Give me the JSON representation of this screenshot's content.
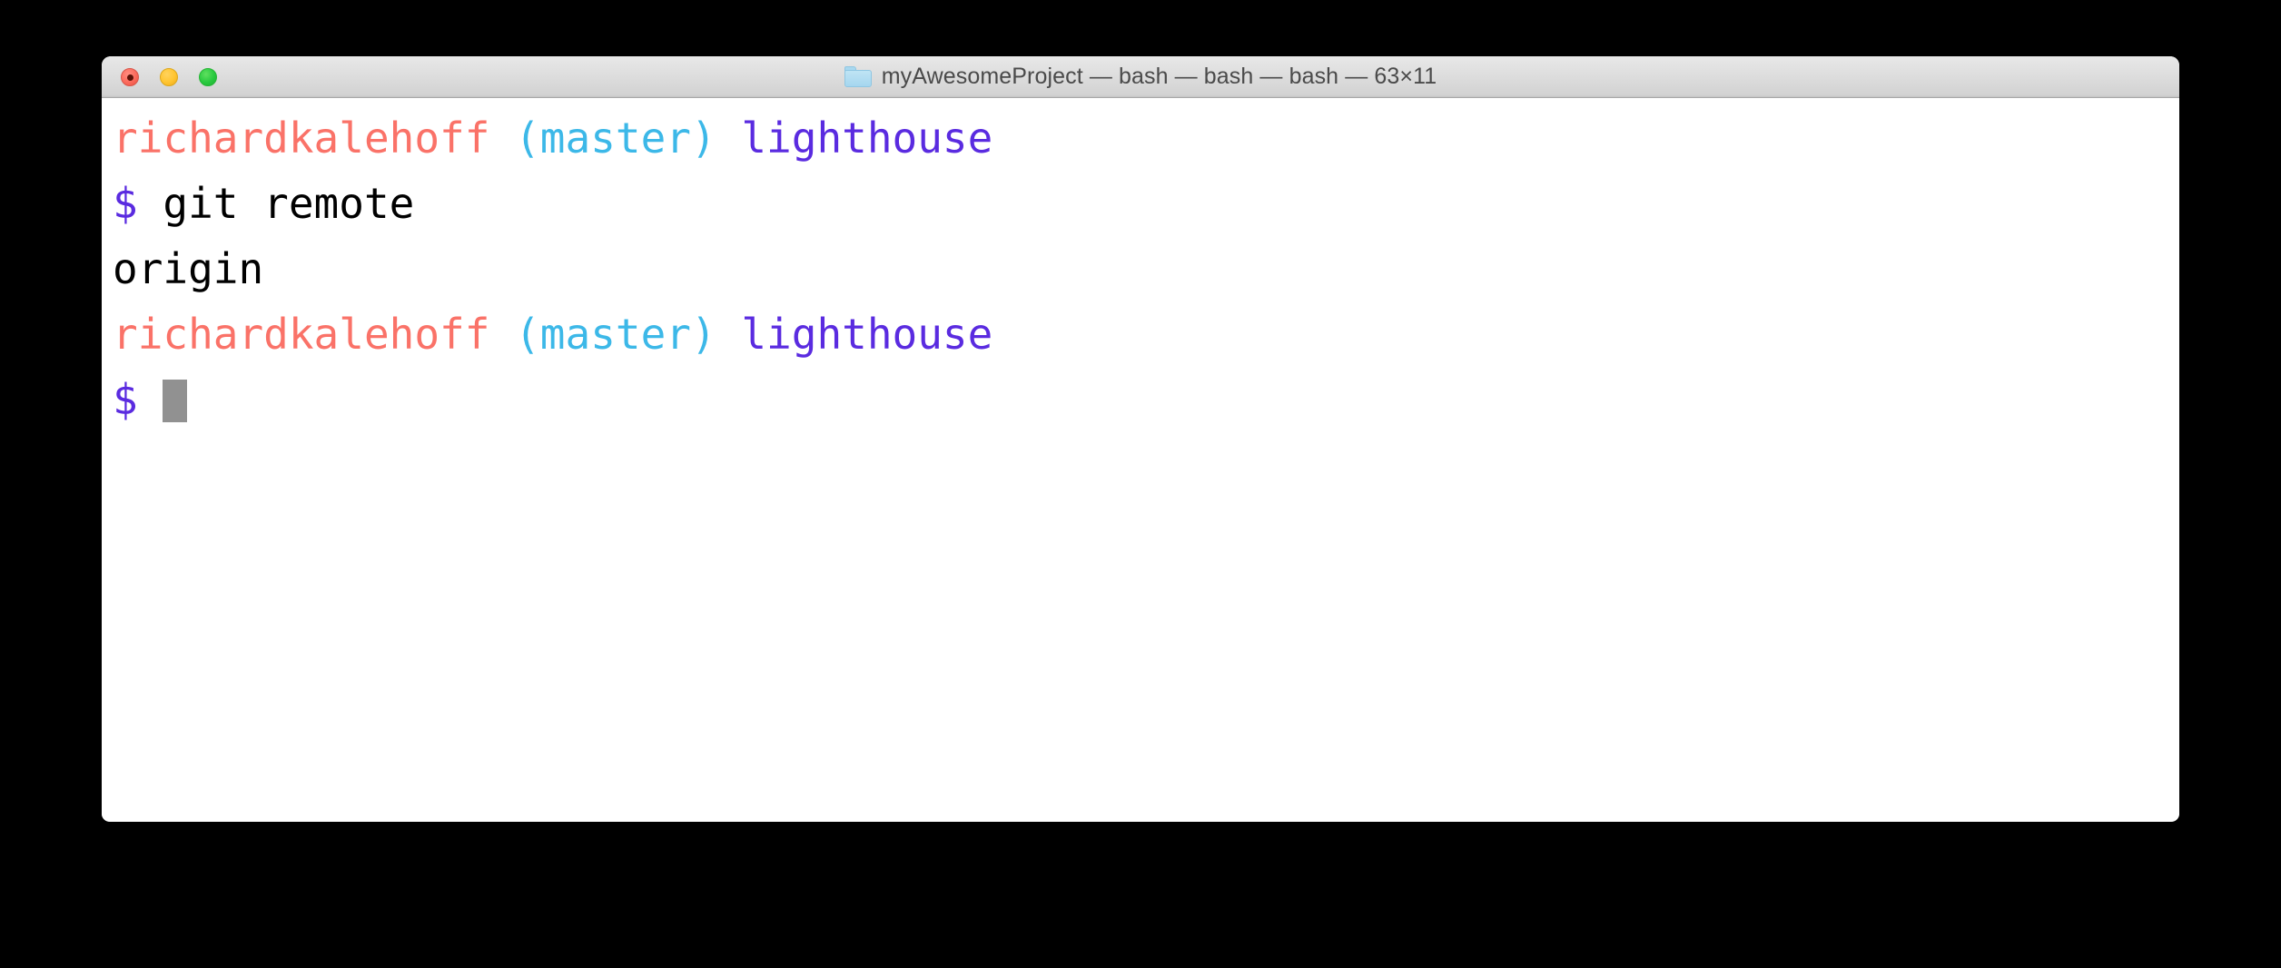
{
  "window": {
    "title_prefix_icon": "folder-icon",
    "title": "myAwesomeProject — bash — bash — bash — 63×11",
    "controls": {
      "close_label": "Close",
      "minimize_label": "Minimize",
      "maximize_label": "Maximize"
    }
  },
  "colors": {
    "username": "#fa7268",
    "branch": "#3cb8e8",
    "directory": "#5a2be0",
    "prompt_symbol": "#5a2be0",
    "output": "#000000",
    "cursor": "#919191",
    "terminal_background": "#ffffff",
    "desktop_background": "#000000",
    "titlebar_top": "#e8e8e8",
    "titlebar_bottom": "#c3c3c3"
  },
  "terminal": {
    "lines": [
      {
        "id": "prompt-line-1",
        "segments": [
          {
            "text": "richardkalehoff ",
            "role": "username"
          },
          {
            "text": "(master) ",
            "role": "branch"
          },
          {
            "text": "lighthouse",
            "role": "directory"
          }
        ]
      },
      {
        "id": "command-line-1",
        "segments": [
          {
            "text": "$ ",
            "role": "prompt"
          },
          {
            "text": "git remote",
            "role": "command"
          }
        ]
      },
      {
        "id": "output-line-1",
        "segments": [
          {
            "text": "origin",
            "role": "output"
          }
        ]
      },
      {
        "id": "prompt-line-2",
        "segments": [
          {
            "text": "richardkalehoff ",
            "role": "username"
          },
          {
            "text": "(master) ",
            "role": "branch"
          },
          {
            "text": "lighthouse",
            "role": "directory"
          }
        ]
      },
      {
        "id": "command-line-2",
        "segments": [
          {
            "text": "$ ",
            "role": "prompt"
          },
          {
            "text": "",
            "role": "cursor"
          }
        ]
      }
    ]
  }
}
